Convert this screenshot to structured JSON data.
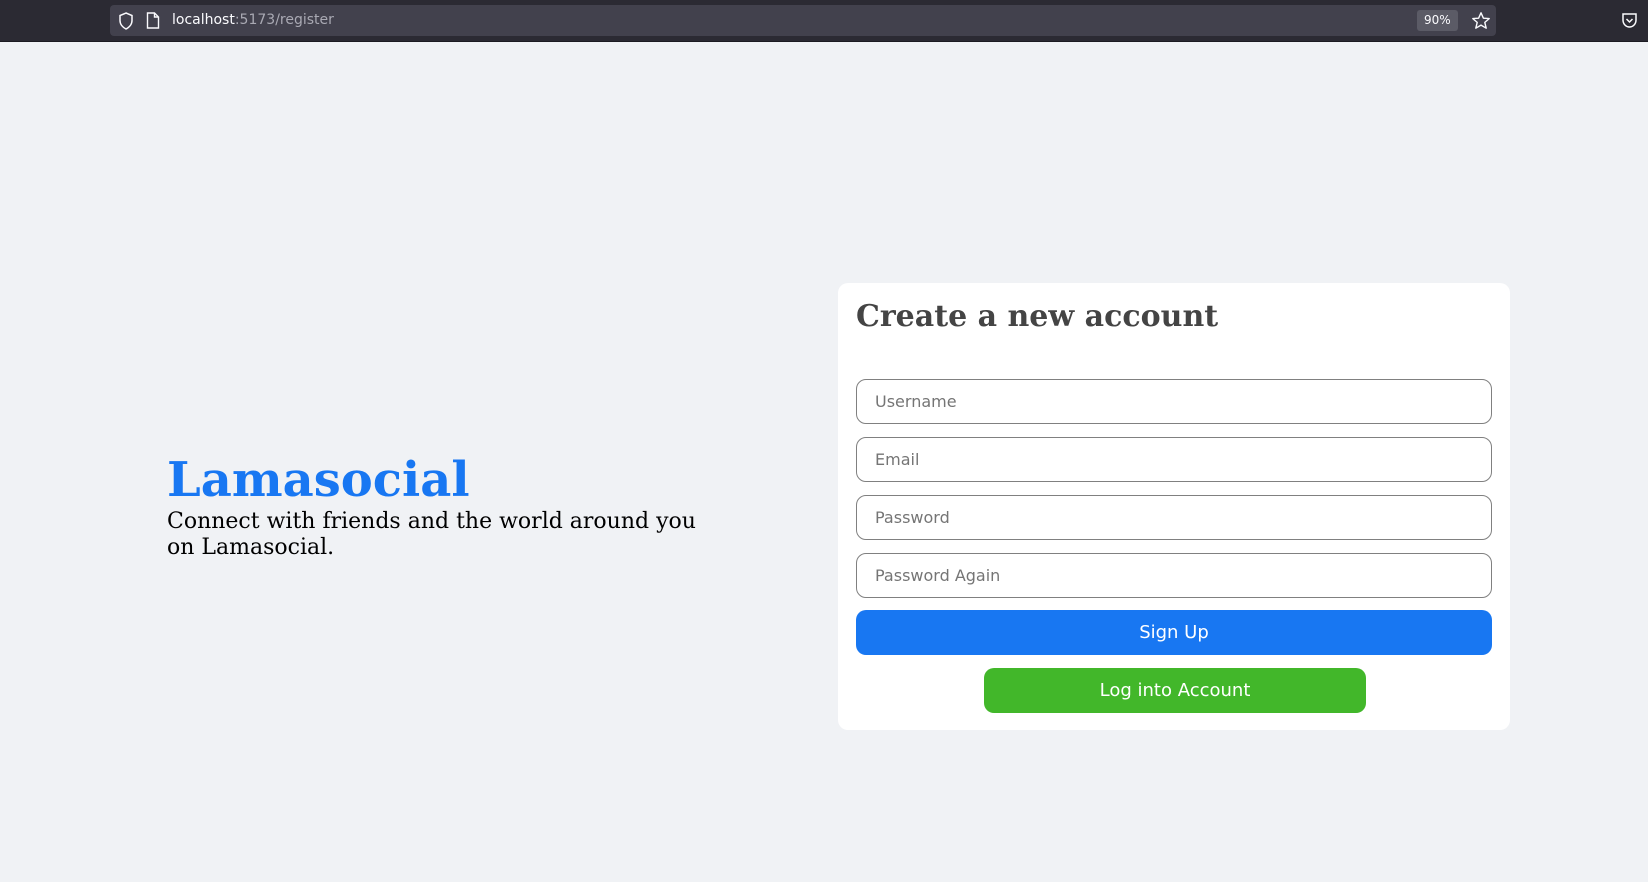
{
  "browser": {
    "url_host": "localhost",
    "url_path": ":5173/register",
    "zoom": "90%"
  },
  "brand": {
    "logo": "Lamasocial",
    "tagline": "Connect with friends and the world around you on Lamasocial."
  },
  "form": {
    "title": "Create a new account",
    "username_placeholder": "Username",
    "email_placeholder": "Email",
    "password_placeholder": "Password",
    "password_again_placeholder": "Password Again",
    "signup_label": "Sign Up",
    "login_label": "Log into Account"
  },
  "colors": {
    "accent_blue": "#1877f2",
    "accent_green": "#42b72a",
    "background": "#f0f2f5"
  }
}
